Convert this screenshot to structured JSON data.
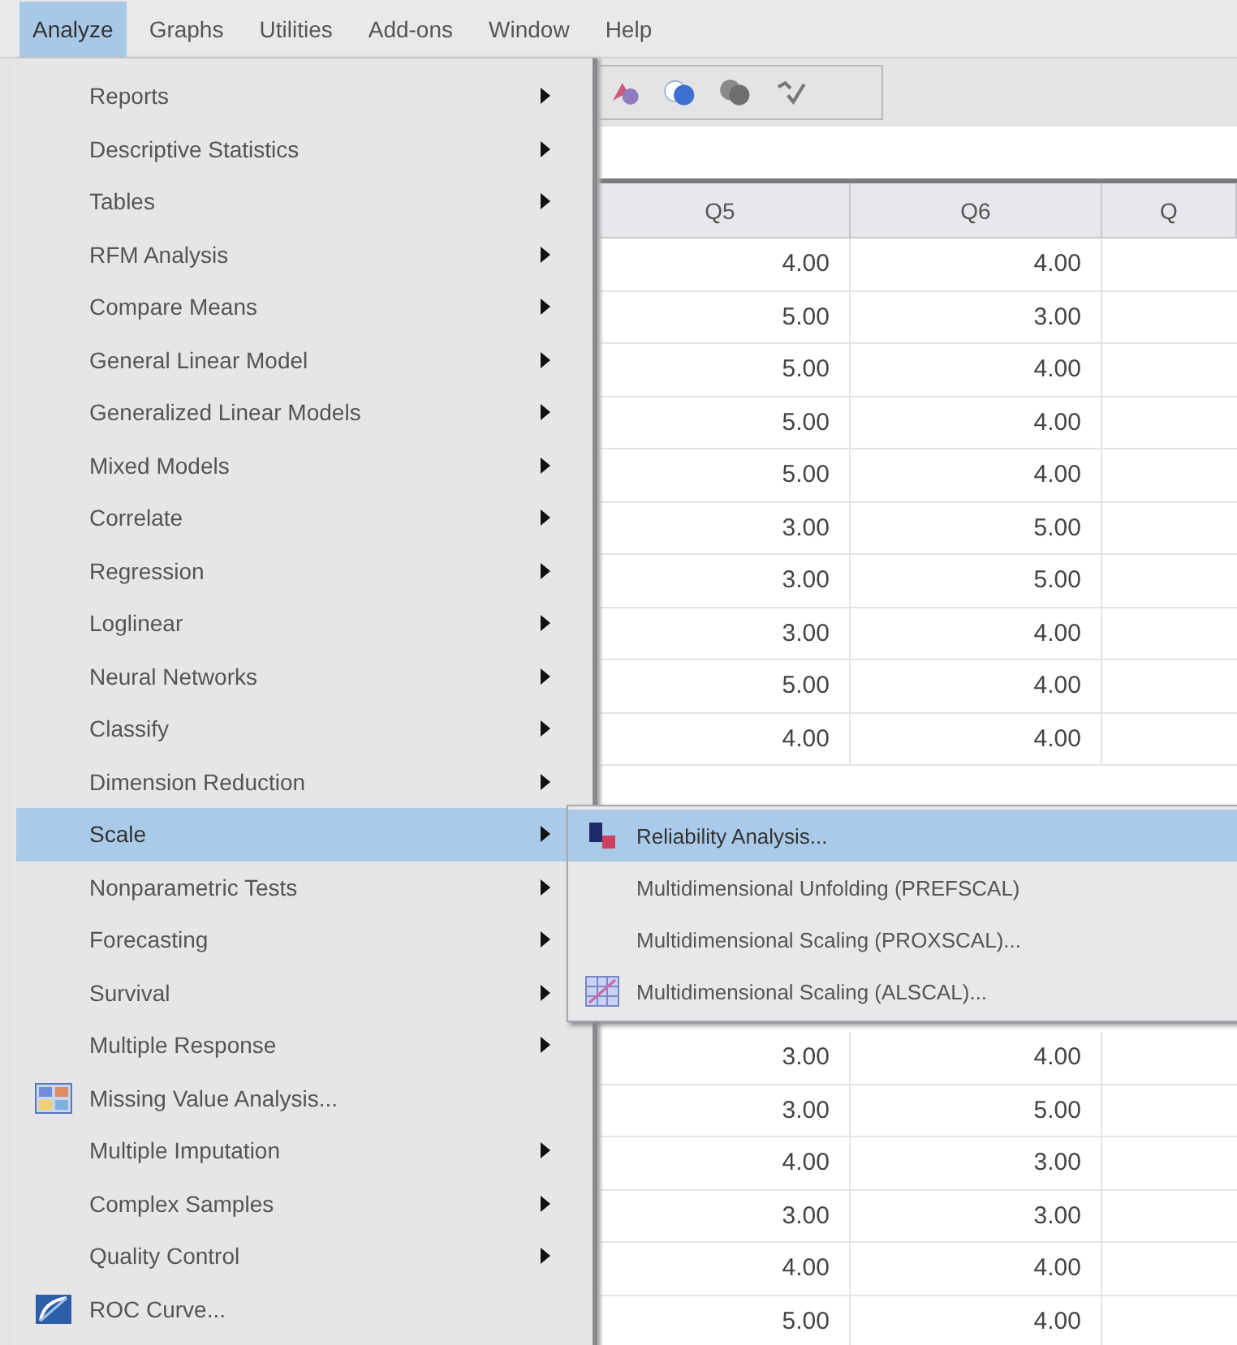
{
  "menubar": [
    {
      "label": "Analyze",
      "selected": true
    },
    {
      "label": "Graphs",
      "selected": false
    },
    {
      "label": "Utilities",
      "selected": false
    },
    {
      "label": "Add-ons",
      "selected": false
    },
    {
      "label": "Window",
      "selected": false
    },
    {
      "label": "Help",
      "selected": false
    }
  ],
  "analyze_menu": {
    "items": [
      {
        "label": "Reports",
        "kind": "submenu",
        "selected": false
      },
      {
        "label": "Descriptive Statistics",
        "kind": "submenu",
        "selected": false
      },
      {
        "label": "Tables",
        "kind": "submenu",
        "selected": false
      },
      {
        "label": "RFM Analysis",
        "kind": "submenu",
        "selected": false
      },
      {
        "label": "Compare Means",
        "kind": "submenu",
        "selected": false
      },
      {
        "label": "General Linear Model",
        "kind": "submenu",
        "selected": false
      },
      {
        "label": "Generalized Linear Models",
        "kind": "submenu",
        "selected": false
      },
      {
        "label": "Mixed Models",
        "kind": "submenu",
        "selected": false
      },
      {
        "label": "Correlate",
        "kind": "submenu",
        "selected": false
      },
      {
        "label": "Regression",
        "kind": "submenu",
        "selected": false
      },
      {
        "label": "Loglinear",
        "kind": "submenu",
        "selected": false
      },
      {
        "label": "Neural Networks",
        "kind": "submenu",
        "selected": false
      },
      {
        "label": "Classify",
        "kind": "submenu",
        "selected": false
      },
      {
        "label": "Dimension Reduction",
        "kind": "submenu",
        "selected": false
      },
      {
        "label": "Scale",
        "kind": "submenu",
        "selected": true
      },
      {
        "label": "Nonparametric Tests",
        "kind": "submenu",
        "selected": false
      },
      {
        "label": "Forecasting",
        "kind": "submenu",
        "selected": false
      },
      {
        "label": "Survival",
        "kind": "submenu",
        "selected": false
      },
      {
        "label": "Multiple Response",
        "kind": "submenu",
        "selected": false
      },
      {
        "label": "Missing Value Analysis...",
        "kind": "grid",
        "selected": false
      },
      {
        "label": "Multiple Imputation",
        "kind": "submenu",
        "selected": false
      },
      {
        "label": "Complex Samples",
        "kind": "submenu",
        "selected": false
      },
      {
        "label": "Quality Control",
        "kind": "submenu",
        "selected": false
      },
      {
        "label": "ROC Curve...",
        "kind": "curve",
        "selected": false
      }
    ]
  },
  "scale_submenu": {
    "items": [
      {
        "label": "Reliability Analysis...",
        "kind": "blocks",
        "selected": true
      },
      {
        "label": "Multidimensional Unfolding (PREFSCAL)",
        "kind": "plain",
        "selected": false
      },
      {
        "label": "Multidimensional Scaling (PROXSCAL)...",
        "kind": "plain",
        "selected": false
      },
      {
        "label": "Multidimensional Scaling (ALSCAL)...",
        "kind": "grid",
        "selected": false
      }
    ]
  },
  "data_view": {
    "columns": [
      "Q5",
      "Q6",
      "Q"
    ],
    "rows_above": [
      [
        "4.00",
        "4.00"
      ],
      [
        "5.00",
        "3.00"
      ],
      [
        "5.00",
        "4.00"
      ],
      [
        "5.00",
        "4.00"
      ],
      [
        "5.00",
        "4.00"
      ],
      [
        "3.00",
        "5.00"
      ],
      [
        "3.00",
        "5.00"
      ],
      [
        "3.00",
        "4.00"
      ],
      [
        "5.00",
        "4.00"
      ],
      [
        "4.00",
        "4.00"
      ]
    ],
    "rows_below": [
      [
        "3.00",
        "4.00"
      ],
      [
        "3.00",
        "5.00"
      ],
      [
        "4.00",
        "3.00"
      ],
      [
        "3.00",
        "3.00"
      ],
      [
        "4.00",
        "4.00"
      ],
      [
        "5.00",
        "4.00"
      ]
    ]
  }
}
